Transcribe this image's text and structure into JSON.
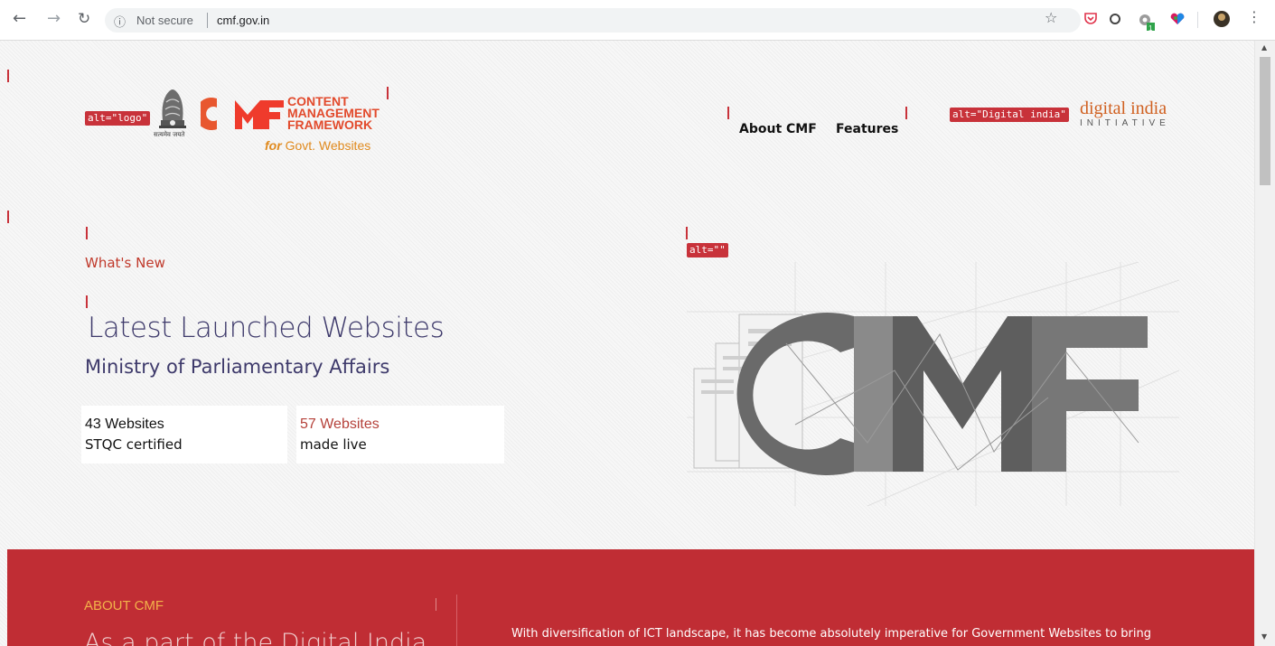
{
  "browser": {
    "url_security": "Not secure",
    "url": "cmf.gov.in",
    "icons": [
      "back-arrow-icon",
      "forward-arrow-icon",
      "reload-icon",
      "info-icon",
      "star-icon",
      "pocket-icon",
      "circle-extension-icon",
      "gear-extension-icon",
      "colorful-heart-extension-icon",
      "profile-avatar-icon",
      "kebab-menu-icon"
    ],
    "extension_badge": "1"
  },
  "header": {
    "logo_alt": "alt=\"logo\"",
    "emblem_caption": "सत्यमेव जयते",
    "cmf_word1": "CONTENT",
    "cmf_word2": "MANAGEMENT",
    "cmf_word3": "FRAMEWORK",
    "for_label": "for",
    "govt_label": "Govt. Websites",
    "nav_about": "About CMF",
    "nav_features": "Features",
    "di_alt": "alt=\"Digital india\"",
    "di_word": "digital india",
    "di_initiative": "INITIATIVE"
  },
  "hero": {
    "whats_new": "What's New",
    "title": "Latest Launched Websites",
    "subtitle": "Ministry of Parliamentary Affairs",
    "art_alt": "alt=\"\"",
    "stats": [
      {
        "number": "43 Websites",
        "label": "STQC certified",
        "color": "#111111"
      },
      {
        "number": "57 Websites",
        "label": "made live",
        "color": "#b5413a"
      }
    ]
  },
  "about": {
    "label": "ABOUT CMF",
    "heading": "As a part of the Digital India",
    "text": "With diversification of ICT landscape, it has become absolutely imperative for Government Websites to bring"
  },
  "colors": {
    "accent_red": "#c02d34",
    "cmf_orange": "#e24a2c",
    "title_purple": "#3e3a6b"
  }
}
